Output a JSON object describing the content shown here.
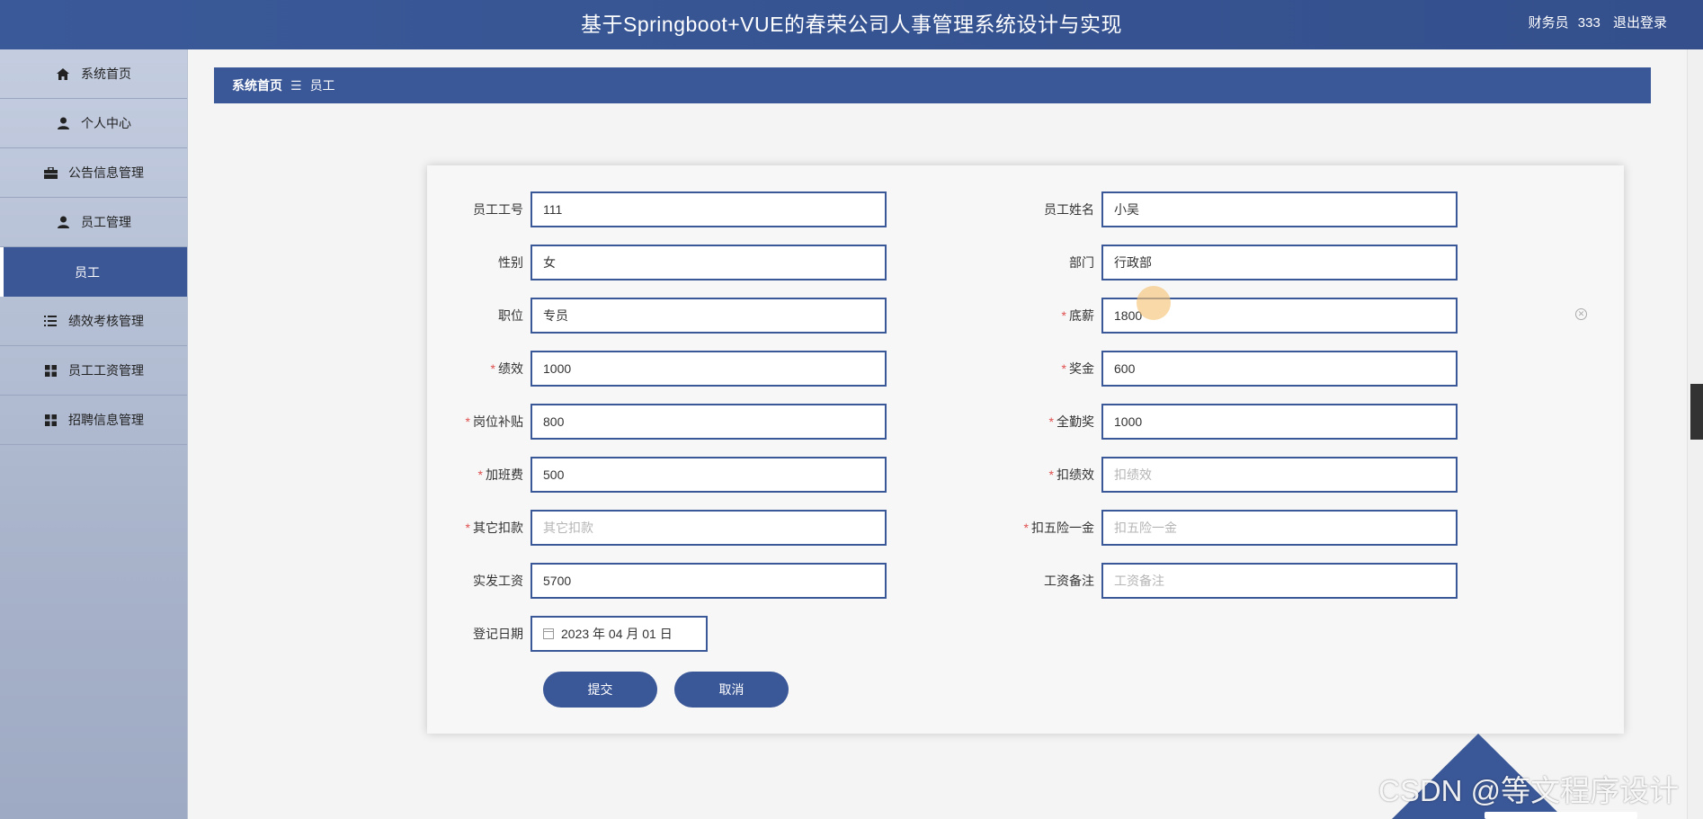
{
  "header": {
    "title": "基于Springboot+VUE的春荣公司人事管理系统设计与实现",
    "user_role": "财务员",
    "user_name": "333",
    "logout": "退出登录"
  },
  "sidebar": {
    "items": [
      {
        "label": "系统首页",
        "icon": "home-icon"
      },
      {
        "label": "个人中心",
        "icon": "user-icon"
      },
      {
        "label": "公告信息管理",
        "icon": "briefcase-icon"
      },
      {
        "label": "员工管理",
        "icon": "user-icon"
      },
      {
        "label": "员工",
        "icon": ""
      },
      {
        "label": "绩效考核管理",
        "icon": "list-icon"
      },
      {
        "label": "员工工资管理",
        "icon": "grid-icon"
      },
      {
        "label": "招聘信息管理",
        "icon": "grid-icon"
      }
    ]
  },
  "breadcrumb": {
    "home": "系统首页",
    "separator": "☰",
    "current": "员工"
  },
  "form": {
    "employee_no": {
      "label": "员工工号",
      "value": "111",
      "required": false
    },
    "employee_name": {
      "label": "员工姓名",
      "value": "小吴",
      "required": false
    },
    "gender": {
      "label": "性别",
      "value": "女",
      "required": false
    },
    "department": {
      "label": "部门",
      "value": "行政部",
      "required": false
    },
    "position": {
      "label": "职位",
      "value": "专员",
      "required": false
    },
    "base_salary": {
      "label": "底薪",
      "value": "1800",
      "required": true
    },
    "performance": {
      "label": "绩效",
      "value": "1000",
      "required": true
    },
    "bonus": {
      "label": "奖金",
      "value": "600",
      "required": true
    },
    "post_allowance": {
      "label": "岗位补贴",
      "value": "800",
      "required": true
    },
    "attendance_bonus": {
      "label": "全勤奖",
      "value": "1000",
      "required": true
    },
    "overtime_pay": {
      "label": "加班费",
      "value": "500",
      "required": true
    },
    "perf_deduction": {
      "label": "扣绩效",
      "placeholder": "扣绩效",
      "required": true
    },
    "other_deduction": {
      "label": "其它扣款",
      "placeholder": "其它扣款",
      "required": true
    },
    "insurance_deduction": {
      "label": "扣五险一金",
      "placeholder": "扣五险一金",
      "required": true
    },
    "actual_salary": {
      "label": "实发工资",
      "value": "5700",
      "required": false
    },
    "salary_note": {
      "label": "工资备注",
      "placeholder": "工资备注",
      "required": false
    },
    "register_date": {
      "label": "登记日期",
      "value": "2023 年 04 月 01 日",
      "required": false
    },
    "submit": "提交",
    "cancel": "取消"
  },
  "required_mark": "*",
  "clear_icon_glyph": "✕",
  "watermark": "CSDN @等文程序设计",
  "colors": {
    "primary": "#3a5797",
    "required": "#e05050",
    "sidebar_bg": "#b4bed3"
  }
}
